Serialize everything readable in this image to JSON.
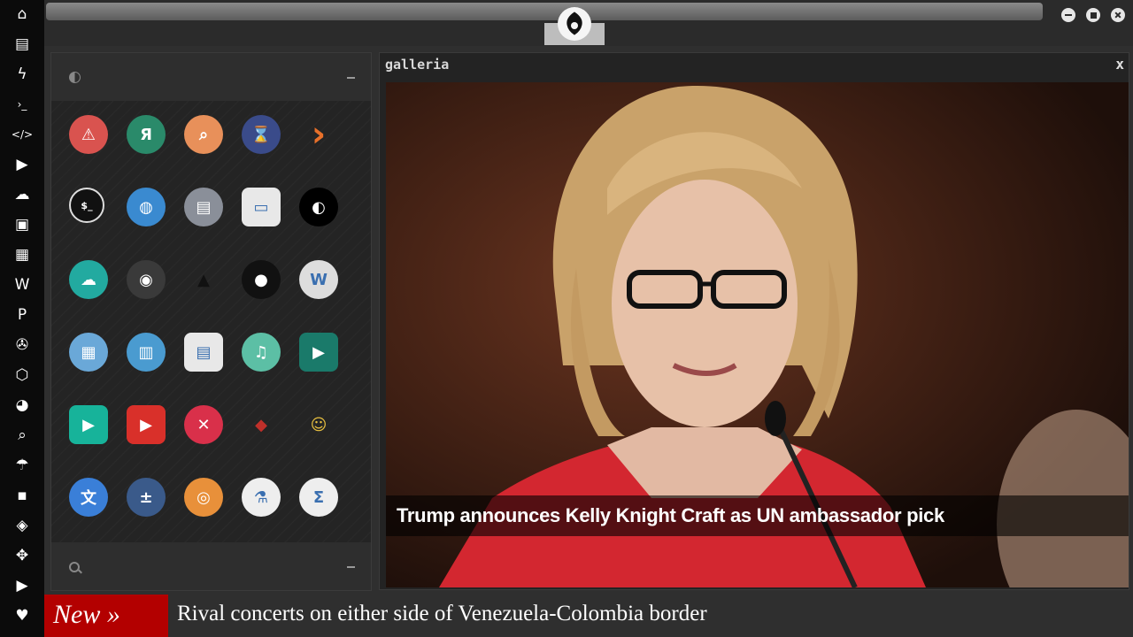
{
  "sidebar": {
    "icons": [
      "home-icon",
      "document-icon",
      "bolt-icon",
      "terminal-icon",
      "code-icon",
      "play-icon",
      "cloud-icon",
      "image-icon",
      "newspaper-icon",
      "wordpress-icon",
      "pinterest-icon",
      "aperture-icon",
      "network-icon",
      "globe-icon",
      "search-icon",
      "umbrella-icon",
      "contacts-icon",
      "git-icon",
      "move-icon",
      "youtube-icon",
      "heart-icon"
    ],
    "glyphs": [
      "⌂",
      "▤",
      "ϟ",
      "›_",
      "</>",
      "▶",
      "☁",
      "▣",
      "▦",
      "W",
      "P",
      "✇",
      "⬡",
      "◕",
      "⌕",
      "☂",
      "▪",
      "◈",
      "✥",
      "▶",
      "♥"
    ]
  },
  "launcher": {
    "apps": [
      {
        "name": "warning-app-icon",
        "glyph": "⚠",
        "color": "#d9534f"
      },
      {
        "name": "yandex-app-icon",
        "glyph": "Я",
        "color": "#2a8a6a"
      },
      {
        "name": "search-app-icon",
        "glyph": "⌕",
        "color": "#e8905a"
      },
      {
        "name": "hourglass-app-icon",
        "glyph": "⌛",
        "color": "#3a4b8a"
      },
      {
        "name": "arrow-app-icon",
        "glyph": "›",
        "color": "transparent"
      },
      {
        "name": "terminal-app-icon",
        "glyph": "$_",
        "color": "#111111"
      },
      {
        "name": "globe-app-icon",
        "glyph": "◍",
        "color": "#3a8ad0"
      },
      {
        "name": "scanner-app-icon",
        "glyph": "▤",
        "color": "#8a8f99"
      },
      {
        "name": "window-app-icon",
        "glyph": "▭",
        "color": "#e8e8e8"
      },
      {
        "name": "cd-app-icon",
        "glyph": "◐",
        "color": "#000000"
      },
      {
        "name": "cloud-lock-app-icon",
        "glyph": "☁",
        "color": "#22aaa0"
      },
      {
        "name": "github-app-icon",
        "glyph": "◉",
        "color": "#3a3a3a"
      },
      {
        "name": "star-trek-app-icon",
        "glyph": "▲",
        "color": "transparent"
      },
      {
        "name": "death-star-app-icon",
        "glyph": "●",
        "color": "#111111"
      },
      {
        "name": "wikipedia-app-icon",
        "glyph": "W",
        "color": "#dddddd"
      },
      {
        "name": "world-map-app-icon",
        "glyph": "▦",
        "color": "#6aa8d8"
      },
      {
        "name": "books-app-icon",
        "glyph": "▥",
        "color": "#4a9bd0"
      },
      {
        "name": "notebook-app-icon",
        "glyph": "▤",
        "color": "#e8e8e8"
      },
      {
        "name": "music-app-icon",
        "glyph": "♫",
        "color": "#5cbfa5"
      },
      {
        "name": "video-app-icon",
        "glyph": "▶",
        "color": "#1a7a6a"
      },
      {
        "name": "player-app-icon",
        "glyph": "▶",
        "color": "#17b39a"
      },
      {
        "name": "youtube-app-icon",
        "glyph": "▶",
        "color": "#d9302a"
      },
      {
        "name": "close-app-icon",
        "glyph": "✕",
        "color": "#d9304a"
      },
      {
        "name": "iron-man-app-icon",
        "glyph": "◆",
        "color": "transparent"
      },
      {
        "name": "c3po-app-icon",
        "glyph": "☺",
        "color": "transparent"
      },
      {
        "name": "translate-app-icon",
        "glyph": "文",
        "color": "#3a7fd8"
      },
      {
        "name": "calculator-app-icon",
        "glyph": "±",
        "color": "#3a5a8a"
      },
      {
        "name": "photos-app-icon",
        "glyph": "◎",
        "color": "#e8903a"
      },
      {
        "name": "flask-app-icon",
        "glyph": "⚗",
        "color": "#eeeeee"
      },
      {
        "name": "formula-app-icon",
        "glyph": "Σ",
        "color": "#eeeeee"
      }
    ]
  },
  "gallery": {
    "title": "galleria",
    "close_label": "x",
    "caption": "Trump announces Kelly Knight Craft as UN ambassador pick"
  },
  "ticker": {
    "badge": "New »",
    "headline": "Rival concerts on either side of Venezuela-Colombia border"
  }
}
